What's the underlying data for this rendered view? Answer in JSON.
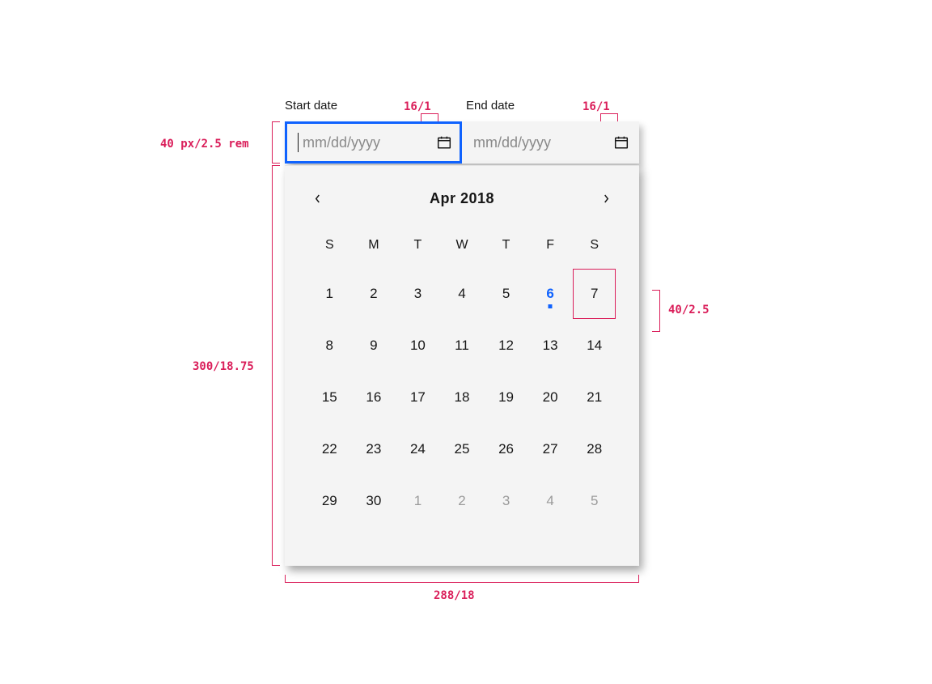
{
  "labels": {
    "start": "Start date",
    "end": "End date"
  },
  "inputs": {
    "start_placeholder": "mm/dd/yyyy",
    "end_placeholder": "mm/dd/yyyy"
  },
  "annotations": {
    "icon_size_1": "16/1",
    "icon_size_2": "16/1",
    "input_height": "40 px/2.5 rem",
    "gap_one": "1",
    "calendar_height": "300/18.75",
    "cell_size": "40/2.5",
    "calendar_width": "288/18"
  },
  "calendar": {
    "month_label": "Apr  2018",
    "dow": [
      "S",
      "M",
      "T",
      "W",
      "T",
      "F",
      "S"
    ],
    "days": [
      {
        "n": "1"
      },
      {
        "n": "2"
      },
      {
        "n": "3"
      },
      {
        "n": "4"
      },
      {
        "n": "5"
      },
      {
        "n": "6",
        "today": true
      },
      {
        "n": "7",
        "boxed": true
      },
      {
        "n": "8"
      },
      {
        "n": "9"
      },
      {
        "n": "10"
      },
      {
        "n": "11"
      },
      {
        "n": "12"
      },
      {
        "n": "13"
      },
      {
        "n": "14"
      },
      {
        "n": "15"
      },
      {
        "n": "16"
      },
      {
        "n": "17"
      },
      {
        "n": "18"
      },
      {
        "n": "19"
      },
      {
        "n": "20"
      },
      {
        "n": "21"
      },
      {
        "n": "22"
      },
      {
        "n": "23"
      },
      {
        "n": "24"
      },
      {
        "n": "25"
      },
      {
        "n": "26"
      },
      {
        "n": "27"
      },
      {
        "n": "28"
      },
      {
        "n": "29"
      },
      {
        "n": "30"
      },
      {
        "n": "1",
        "off": true
      },
      {
        "n": "2",
        "off": true
      },
      {
        "n": "3",
        "off": true
      },
      {
        "n": "4",
        "off": true
      },
      {
        "n": "5",
        "off": true
      }
    ]
  }
}
